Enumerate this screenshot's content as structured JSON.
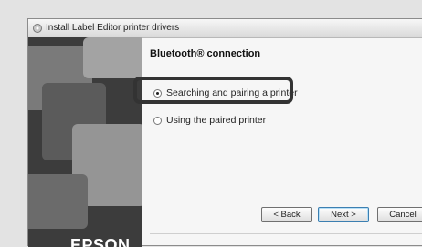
{
  "window": {
    "title": "Install Label Editor printer drivers"
  },
  "sidebar": {
    "logo_text": "EPSON"
  },
  "main": {
    "heading": "Bluetooth® connection",
    "options": [
      {
        "label": "Searching and pairing a printer",
        "selected": true
      },
      {
        "label": "Using the paired printer",
        "selected": false
      }
    ]
  },
  "buttons": {
    "back": "< Back",
    "next": "Next >",
    "cancel": "Cancel"
  }
}
